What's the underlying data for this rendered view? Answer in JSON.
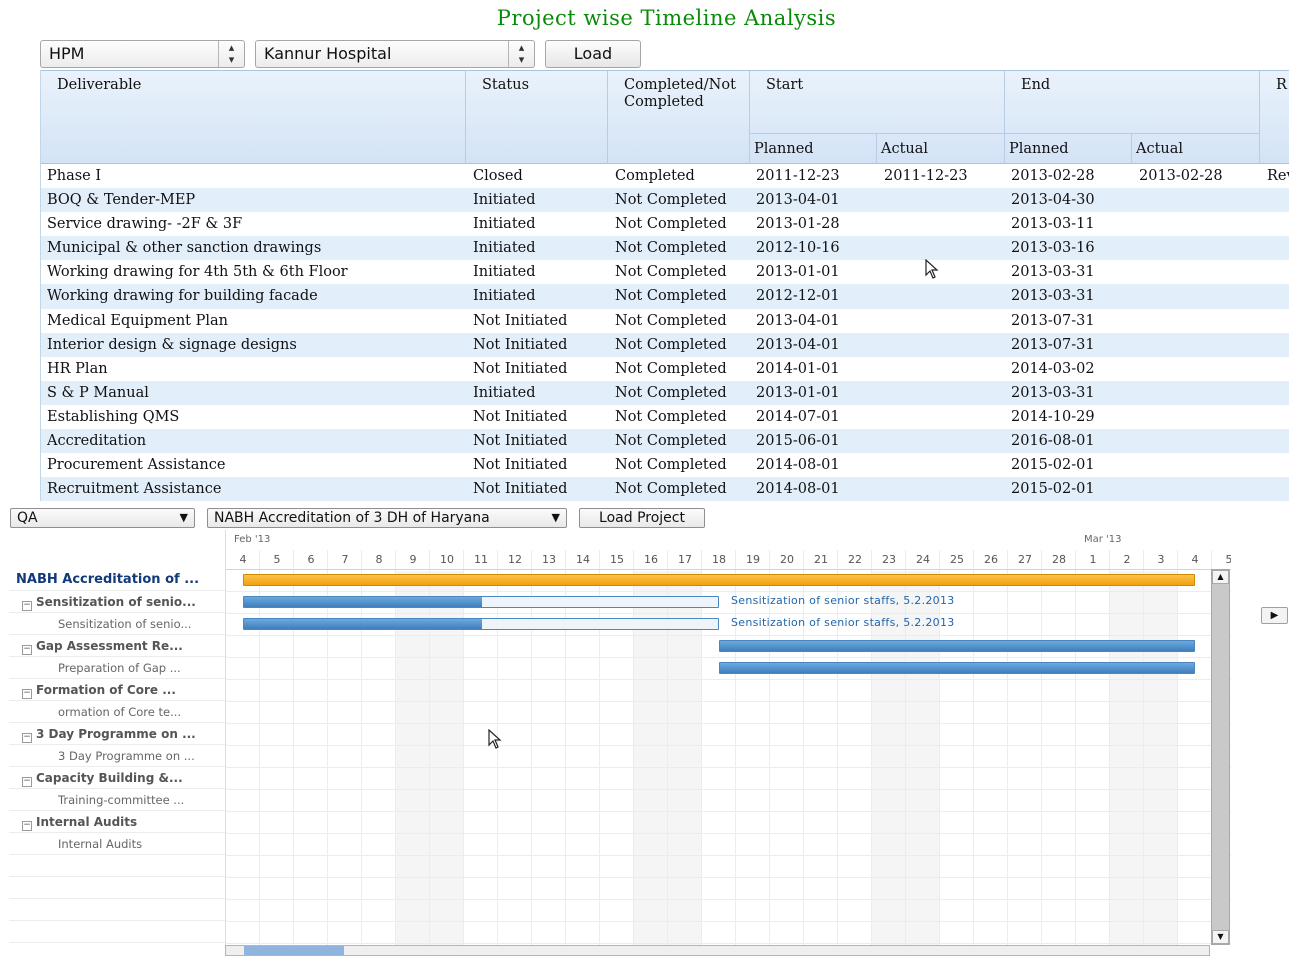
{
  "page": {
    "title": "Project wise Timeline Analysis"
  },
  "controls": {
    "department": "HPM",
    "project": "Kannur Hospital",
    "load_label": "Load"
  },
  "table": {
    "headers": {
      "deliverable": "Deliverable",
      "status": "Status",
      "completed": "Completed/Not Completed",
      "start": "Start",
      "end": "End",
      "planned": "Planned",
      "actual": "Actual",
      "remarks_truncated": "R"
    },
    "rows": [
      {
        "d": "Phase I",
        "s": "Closed",
        "c": "Completed",
        "sp": "2011-12-23",
        "sa": "2011-12-23",
        "ep": "2013-02-28",
        "ea": "2013-02-28",
        "r": "Rev"
      },
      {
        "d": "BOQ & Tender-MEP",
        "s": "Initiated",
        "c": "Not Completed",
        "sp": "2013-04-01",
        "sa": "",
        "ep": "2013-04-30",
        "ea": "",
        "r": ""
      },
      {
        "d": "Service drawing- -2F & 3F",
        "s": "Initiated",
        "c": "Not Completed",
        "sp": "2013-01-28",
        "sa": "",
        "ep": "2013-03-11",
        "ea": "",
        "r": ""
      },
      {
        "d": "Municipal & other sanction drawings",
        "s": "Initiated",
        "c": "Not Completed",
        "sp": "2012-10-16",
        "sa": "",
        "ep": "2013-03-16",
        "ea": "",
        "r": ""
      },
      {
        "d": "Working drawing for 4th 5th & 6th Floor",
        "s": "Initiated",
        "c": "Not Completed",
        "sp": "2013-01-01",
        "sa": "",
        "ep": "2013-03-31",
        "ea": "",
        "r": ""
      },
      {
        "d": "Working drawing for building facade",
        "s": "Initiated",
        "c": "Not Completed",
        "sp": "2012-12-01",
        "sa": "",
        "ep": "2013-03-31",
        "ea": "",
        "r": ""
      },
      {
        "d": "Medical Equipment Plan",
        "s": "Not Initiated",
        "c": "Not Completed",
        "sp": "2013-04-01",
        "sa": "",
        "ep": "2013-07-31",
        "ea": "",
        "r": ""
      },
      {
        "d": "Interior design & signage designs",
        "s": "Not Initiated",
        "c": "Not Completed",
        "sp": "2013-04-01",
        "sa": "",
        "ep": "2013-07-31",
        "ea": "",
        "r": ""
      },
      {
        "d": "HR Plan",
        "s": "Not Initiated",
        "c": "Not Completed",
        "sp": "2014-01-01",
        "sa": "",
        "ep": "2014-03-02",
        "ea": "",
        "r": ""
      },
      {
        "d": "S & P Manual",
        "s": "Initiated",
        "c": "Not Completed",
        "sp": "2013-01-01",
        "sa": "",
        "ep": "2013-03-31",
        "ea": "",
        "r": ""
      },
      {
        "d": "Establishing QMS",
        "s": "Not Initiated",
        "c": "Not Completed",
        "sp": "2014-07-01",
        "sa": "",
        "ep": "2014-10-29",
        "ea": "",
        "r": ""
      },
      {
        "d": "Accreditation",
        "s": "Not Initiated",
        "c": "Not Completed",
        "sp": "2015-06-01",
        "sa": "",
        "ep": "2016-08-01",
        "ea": "",
        "r": ""
      },
      {
        "d": "Procurement Assistance",
        "s": "Not Initiated",
        "c": "Not Completed",
        "sp": "2014-08-01",
        "sa": "",
        "ep": "2015-02-01",
        "ea": "",
        "r": ""
      },
      {
        "d": "Recruitment Assistance",
        "s": "Not Initiated",
        "c": "Not Completed",
        "sp": "2014-08-01",
        "sa": "",
        "ep": "2015-02-01",
        "ea": "",
        "r": ""
      }
    ]
  },
  "gantt": {
    "filter": "QA",
    "project": "NABH Accreditation of 3 DH of Haryana",
    "load_label": "Load Project",
    "months": [
      {
        "label": "Feb '13",
        "start_index": 0
      },
      {
        "label": "Mar '13",
        "start_index": 25
      }
    ],
    "days": [
      "4",
      "5",
      "6",
      "7",
      "8",
      "9",
      "10",
      "11",
      "12",
      "13",
      "14",
      "15",
      "16",
      "17",
      "18",
      "19",
      "20",
      "21",
      "22",
      "23",
      "24",
      "25",
      "26",
      "27",
      "28",
      "1",
      "2",
      "3",
      "4",
      "5"
    ],
    "weekend_indices": [
      5,
      6,
      12,
      13,
      19,
      20,
      26,
      27
    ],
    "tasks": [
      {
        "name": "NABH Accreditation of ...",
        "level": "root",
        "bar": {
          "start": 0.5,
          "end": 28.5,
          "progress": 1,
          "kind": "summary"
        }
      },
      {
        "name": "Sensitization of senio...",
        "level": "grp",
        "bar": {
          "start": 0.5,
          "end": 14.5,
          "progress": 0.5,
          "kind": "task"
        },
        "label": "Sensitization of senior staffs, 5.2.2013"
      },
      {
        "name": "Sensitization of senio...",
        "level": "leaf",
        "bar": {
          "start": 0.5,
          "end": 14.5,
          "progress": 0.5,
          "kind": "task"
        },
        "label": "Sensitization of senior staffs, 5.2.2013"
      },
      {
        "name": "Gap Assessment Re...",
        "level": "grp",
        "bar": {
          "start": 14.5,
          "end": 28.5,
          "progress": 1,
          "kind": "task"
        }
      },
      {
        "name": "Preparation of Gap ...",
        "level": "leaf",
        "bar": {
          "start": 14.5,
          "end": 28.5,
          "progress": 1,
          "kind": "task"
        }
      },
      {
        "name": "Formation of Core ...",
        "level": "grp"
      },
      {
        "name": "ormation of Core te...",
        "level": "leaf"
      },
      {
        "name": "3 Day Programme on ...",
        "level": "grp"
      },
      {
        "name": "3 Day Programme on ...",
        "level": "leaf"
      },
      {
        "name": "Capacity Building &...",
        "level": "grp"
      },
      {
        "name": "Training-committee ...",
        "level": "leaf"
      },
      {
        "name": "Internal Audits",
        "level": "grp"
      },
      {
        "name": "Internal Audits",
        "level": "leaf"
      }
    ]
  }
}
